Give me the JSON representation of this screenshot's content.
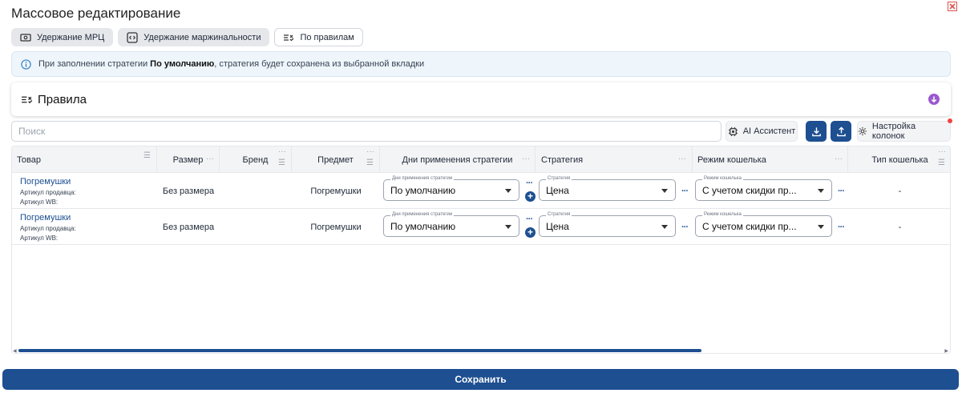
{
  "dialog": {
    "title": "Массовое редактирование",
    "save_label": "Сохранить"
  },
  "tabs": [
    {
      "label": "Удержание МРЦ",
      "icon": "money-icon"
    },
    {
      "label": "Удержание маржинальности",
      "icon": "code-icon"
    },
    {
      "label": "По правилам",
      "icon": "rules-icon"
    }
  ],
  "info": {
    "before": "При заполнении стратегии ",
    "bold": "По умолчанию",
    "after": ", стратегия будет сохранена из выбранной вкладки"
  },
  "rules": {
    "title": "Правила"
  },
  "toolbar": {
    "search_placeholder": "Поиск",
    "ai_label": "AI Ассистент",
    "columns_label": "Настройка колонок"
  },
  "columns": [
    "Товар",
    "Размер",
    "Бренд",
    "Предмет",
    "Дни применения стратегии",
    "Стратегия",
    "Режим кошелька",
    "Тип кошелька"
  ],
  "field_labels": {
    "days": "Дни применения стратегии",
    "strategy": "Стратегия",
    "wallet": "Режим кошелька"
  },
  "rows": [
    {
      "name": "Погремушки",
      "seller_article": "Артикул продавца:",
      "wb_article": "Артикул WB:",
      "size": "Без размера",
      "brand": "",
      "subject": "Погремушки",
      "days": "По умолчанию",
      "strategy": "Цена",
      "wallet": "С учетом скидки пр...",
      "wallet_type": "-"
    },
    {
      "name": "Погремушки",
      "seller_article": "Артикул продавца:",
      "wb_article": "Артикул WB:",
      "size": "Без размера",
      "brand": "",
      "subject": "Погремушки",
      "days": "По умолчанию",
      "strategy": "Цена",
      "wallet": "С учетом скидки пр...",
      "wallet_type": "-"
    }
  ],
  "colors": {
    "accent": "#1d4f91",
    "info_bg": "#eef6fc",
    "alert": "#ef4444",
    "expand": "#9b59d0"
  }
}
